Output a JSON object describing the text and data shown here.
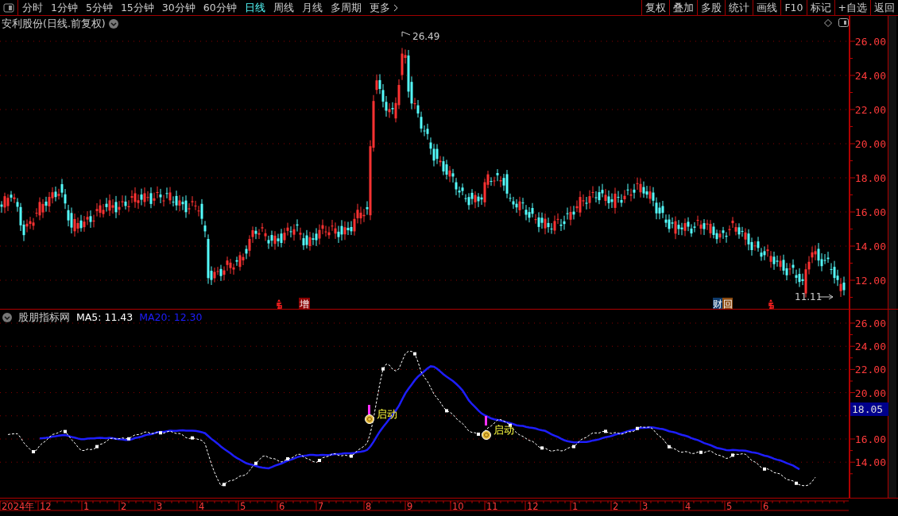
{
  "toolbar": {
    "periods": [
      {
        "label": "分时",
        "selected": false
      },
      {
        "label": "1分钟",
        "selected": false
      },
      {
        "label": "5分钟",
        "selected": false
      },
      {
        "label": "15分钟",
        "selected": false
      },
      {
        "label": "30分钟",
        "selected": false
      },
      {
        "label": "60分钟",
        "selected": false
      },
      {
        "label": "日线",
        "selected": true
      },
      {
        "label": "周线",
        "selected": false
      },
      {
        "label": "月线",
        "selected": false
      },
      {
        "label": "多周期",
        "selected": false
      }
    ],
    "more": "更多",
    "buttons": [
      "复权",
      "叠加",
      "多股",
      "统计",
      "画线",
      "F10",
      "标记",
      "+自选",
      "返回"
    ]
  },
  "main_chart": {
    "title": "安利股份(日线.前复权)",
    "high_label": "26.49",
    "low_label": "11.11",
    "y_axis": [
      "26.00",
      "24.00",
      "22.00",
      "20.00",
      "18.00",
      "16.00",
      "14.00",
      "12.00"
    ],
    "markers": [
      {
        "kind": "dollar"
      },
      {
        "kind": "tag",
        "label": "增"
      },
      {
        "kind": "pair",
        "label": "财",
        "label2": "回"
      },
      {
        "kind": "dollar"
      }
    ]
  },
  "indicator": {
    "name": "股朋指标网",
    "ma5": "MA5: 11.43",
    "ma20": "MA20: 12.30",
    "y_axis": [
      "26.00",
      "24.00",
      "22.00",
      "20.00",
      "16.00",
      "14.00"
    ],
    "current_value": "18.05",
    "signals": [
      {
        "label": "启动"
      },
      {
        "label": "启动"
      }
    ]
  },
  "date_axis": [
    "2024年",
    "12",
    "1",
    "2",
    "3",
    "4",
    "5",
    "6",
    "7",
    "8",
    "9",
    "10",
    "11",
    "12",
    "1",
    "2",
    "3",
    "4",
    "5",
    "6"
  ]
}
